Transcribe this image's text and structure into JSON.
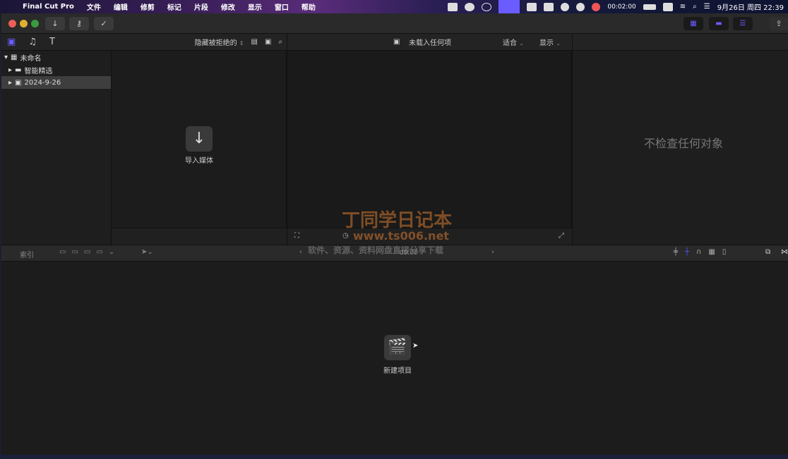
{
  "menubar": {
    "app_name": "Final Cut Pro",
    "menus": [
      "文件",
      "编辑",
      "修剪",
      "标记",
      "片段",
      "修改",
      "显示",
      "窗口",
      "帮助"
    ],
    "recording_time": "00:02:00",
    "date_time": "9月26日 周四  22:39"
  },
  "library": {
    "items": [
      {
        "label": "未命名",
        "expanded": true
      },
      {
        "label": "智能精选",
        "expanded": false
      },
      {
        "label": "2024-9-26",
        "expanded": false,
        "selected": true
      }
    ]
  },
  "browser": {
    "filter": "隐藏被拒绝的",
    "import_label": "导入媒体"
  },
  "viewer": {
    "title": "未载入任何项",
    "fit": "适合",
    "display": "显示"
  },
  "inspector": {
    "empty_text": "不检查任何对象"
  },
  "timeline": {
    "index_label": "索引",
    "timecode": "00:00",
    "new_project_label": "新建项目"
  },
  "watermark": {
    "title": "丁同学日记本",
    "url": "www.ts006.net",
    "tagline": "软件、资源、资料网盘直接分享下载"
  }
}
